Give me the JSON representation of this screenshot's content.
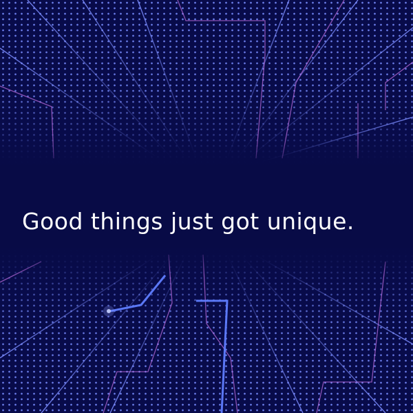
{
  "headline": "Good things just got unique.",
  "colors": {
    "background": "#080b4a",
    "dots": "#7888ff",
    "rays": "#5a6cff",
    "circuit_lines": "#b66ad8",
    "text": "#ffffff"
  }
}
